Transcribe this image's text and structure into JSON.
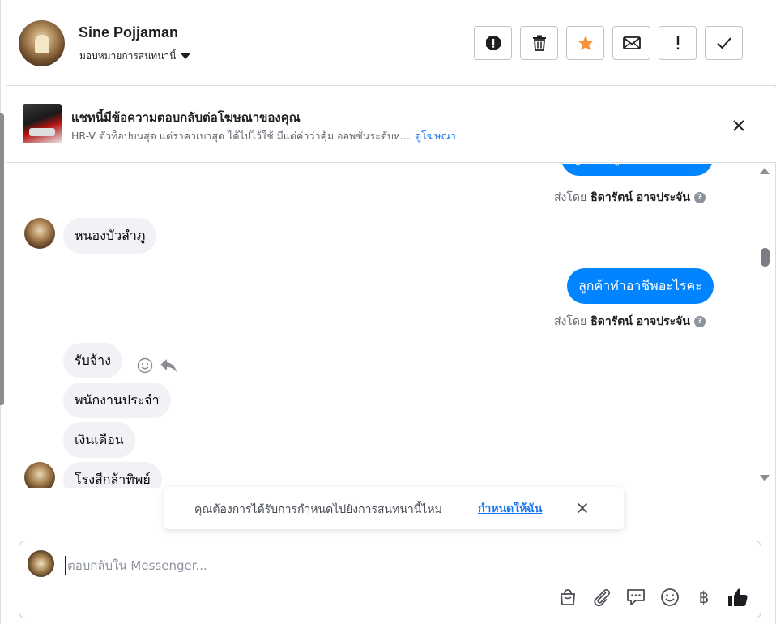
{
  "header": {
    "contact_name": "Sine Pojjaman",
    "assign_label": "มอบหมายการสนทนานี้",
    "actions": [
      {
        "name": "spam-button",
        "icon": "alert-octagon-icon"
      },
      {
        "name": "delete-button",
        "icon": "trash-icon"
      },
      {
        "name": "follow-up-button",
        "icon": "star-icon"
      },
      {
        "name": "mark-unread-button",
        "icon": "envelope-icon"
      },
      {
        "name": "important-button",
        "icon": "exclamation-icon"
      },
      {
        "name": "mark-done-button",
        "icon": "checkmark-icon"
      }
    ],
    "star_color": "#f7923b"
  },
  "ad_banner": {
    "title": "แชทนี้มีข้อความตอบกลับต่อโฆษณาของคุณ",
    "subtitle": "HR-V ตัวท็อปบนสุด แต่ราคาเบาสุด ได้ไปไว้ใช้ มีแต่ค่าว่าคุ้ม ออพชั่นระดับห...",
    "link": "ดูโฆษณา"
  },
  "messages": {
    "partial_out": "ลูกค้าอยู่จังหวัดอะไรคะ",
    "sent_by_prefix": "ส่งโดย",
    "sent_by_name": "ธิดารัตน์ อาจประจัน",
    "in_1": "หนองบัวลำภู",
    "out_1": "ลูกค้าทำอาชีพอะไรคะ",
    "in_2": "รับจ้าง",
    "in_3": "พนักงานประจำ",
    "in_4": "เงินเดือน",
    "in_5": "โรงสีกล้าทิพย์"
  },
  "toast": {
    "text": "คุณต้องการได้รับการกำหนดไปยังการสนทนานี้ไหม",
    "link": "กำหนดให้ฉัน"
  },
  "composer": {
    "placeholder": "ตอบกลับใน Messenger...",
    "tools": [
      "bag-icon",
      "paperclip-icon",
      "saved-reply-icon",
      "emoji-icon",
      "baht-icon",
      "thumbs-up-icon"
    ],
    "baht_symbol": "฿"
  },
  "colors": {
    "outgoing_bubble": "#0084ff",
    "incoming_bubble": "#f0f2f5",
    "link": "#1877f2"
  }
}
